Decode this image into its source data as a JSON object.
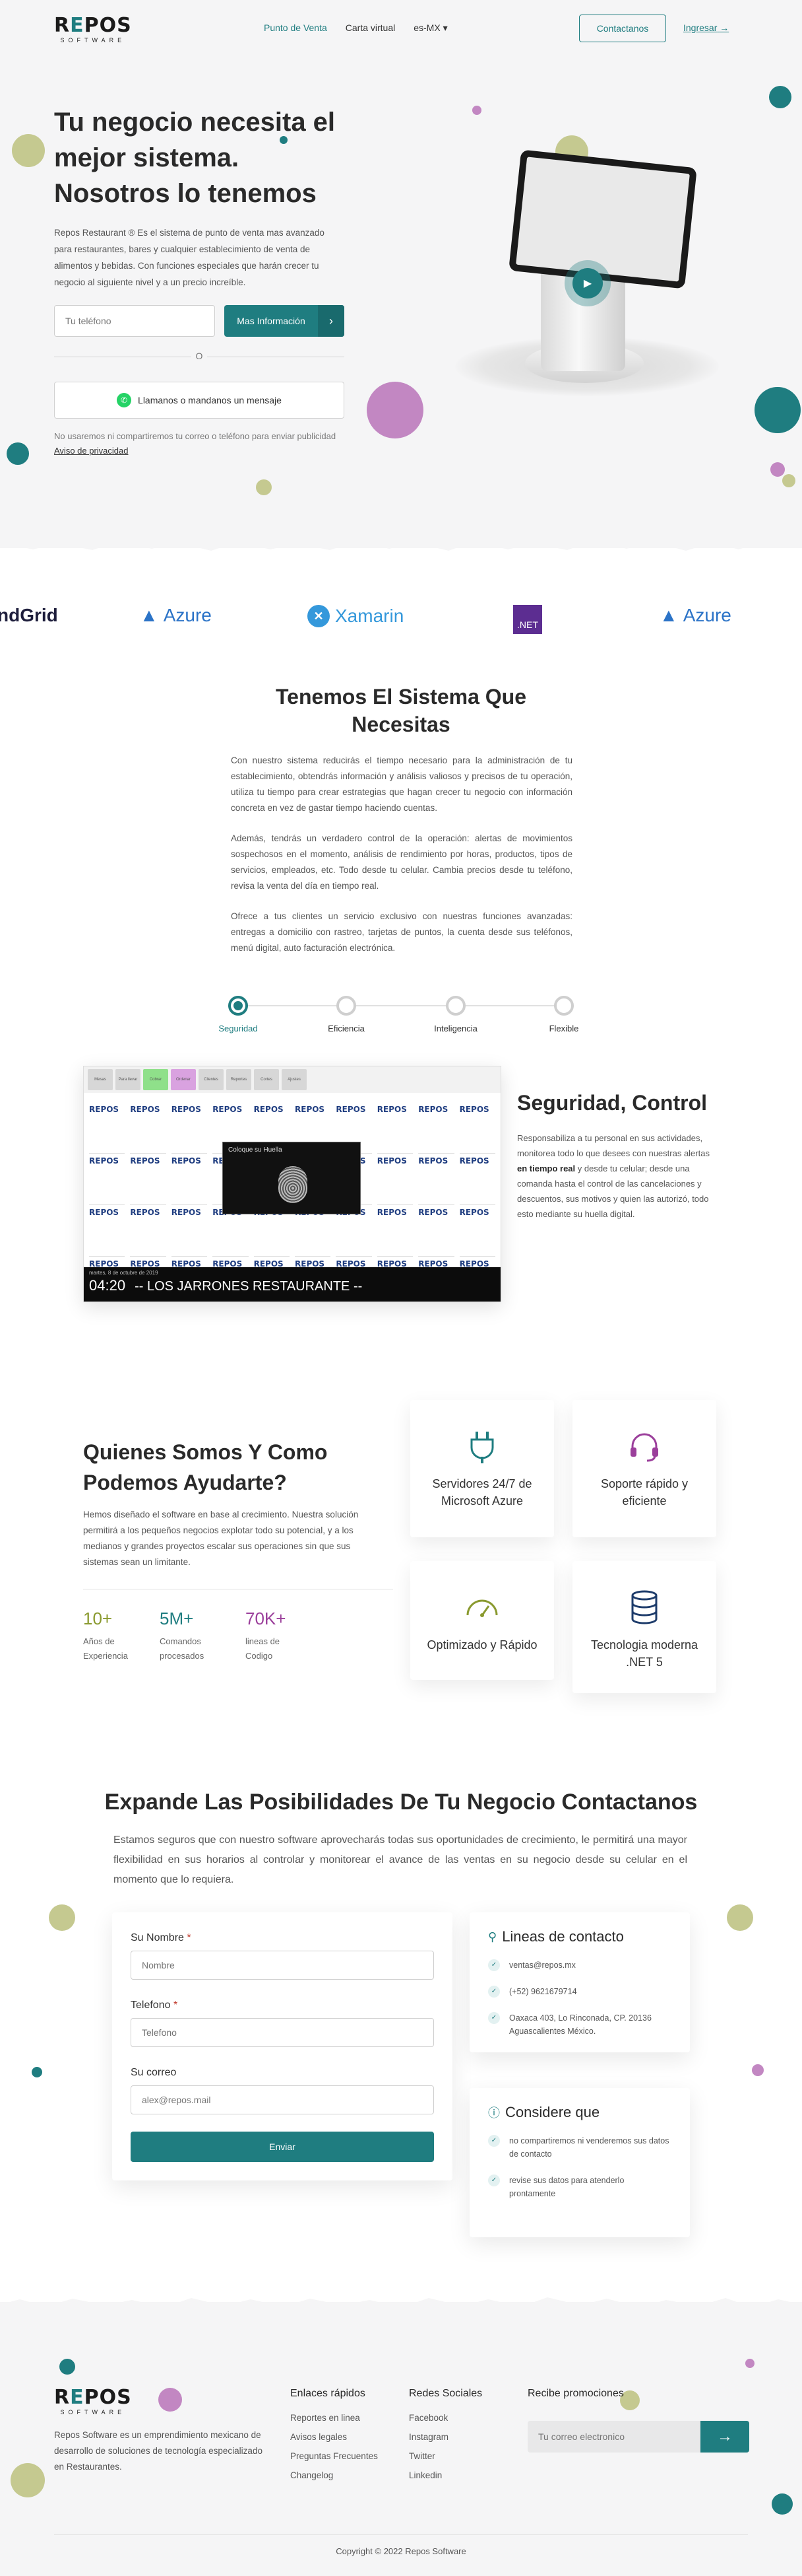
{
  "header": {
    "logo": {
      "word_a": "R",
      "word_e": "E",
      "word_b": "POS",
      "sub": "SOFTWARE"
    },
    "nav": [
      "Punto de Venta",
      "Carta virtual",
      "es-MX"
    ],
    "contact_button": "Contactanos",
    "login_link": "Ingresar"
  },
  "hero": {
    "title_line1": "Tu negocio necesita el",
    "title_line2": "mejor sistema.",
    "title_bold": "Nosotros lo tenemos",
    "description": "Repos Restaurant ® Es el sistema de punto de venta mas avanzado para restaurantes, bares y cualquier establecimiento de venta de alimentos y bebidas. Con funciones especiales que harán crecer tu negocio al siguiente nivel y a un precio increíble.",
    "phone_placeholder": "Tu teléfono",
    "info_button": "Mas Información",
    "or": "O",
    "whatsapp_button": "Llamanos o mandanos un mensaje",
    "privacy_text": "No usaremos ni compartiremos tu correo o teléfono para enviar publicidad",
    "privacy_link": "Aviso de privacidad"
  },
  "tech_strip": [
    {
      "name": "ndGrid",
      "mark": ""
    },
    {
      "name": "Azure",
      "mark": "▲"
    },
    {
      "name": "Xamarin",
      "mark": "✕"
    },
    {
      "name": ".NET",
      "mark": ""
    },
    {
      "name": "Azure",
      "mark": "▲"
    }
  ],
  "sistema": {
    "title_plain": "Tenemos ",
    "title_bold": "El Sistema Que Necesitas",
    "p1": "Con nuestro sistema reducirás el tiempo necesario para la administración de tu establecimiento, obtendrás información y análisis valiosos y precisos de tu operación, utiliza tu tiempo para crear estrategias que hagan crecer tu negocio con información concreta en vez de gastar tiempo haciendo cuentas.",
    "p2_a": "Además, tendrás un verdadero control de la operación: alertas de movimientos sospechosos en el momento, análisis de rendimiento por horas, productos, tipos de servicios, empleados, etc. Todo desde tu celular. Cambia precios desde tu teléfono, revisa la venta del día en tiempo real.",
    "p3": "Ofrece a tus clientes un servicio exclusivo con nuestras funciones avanzadas: entregas a domicilio con rastreo, tarjetas de puntos, la cuenta desde sus teléfonos, menú digital, auto facturación electrónica.",
    "steps": [
      "Seguridad",
      "Eficiencia",
      "Inteligencia",
      "Flexible"
    ]
  },
  "screenshot": {
    "toolbar": [
      "Mesas",
      "Para llevar",
      "Cobrar",
      "Ordenar",
      "Clientes",
      "Reportes",
      "Cortes",
      "Ajustes"
    ],
    "tiles_logo": "REPOS",
    "modal_title": "Coloque su Huella",
    "date": "martes, 8 de octubre de 2019",
    "time": "04:20",
    "restaurant": "-- LOS JARRONES RESTAURANTE --"
  },
  "control": {
    "title_plain": "Seguridad, ",
    "title_bold": "Control",
    "desc_a": "Responsabiliza a tu personal en sus actividades, monitorea todo lo que desees con nuestras alertas ",
    "desc_bold": "en tiempo real",
    "desc_b": " y desde tu celular; desde una comanda hasta el control de las cancelaciones y descuentos, sus motivos y quien las autorizó, todo esto mediante su huella digital."
  },
  "quienes": {
    "title_plain": "Quienes Somos Y ",
    "title_bold": "Como Podemos Ayudarte?",
    "description": "Hemos diseñado el software en base al crecimiento. Nuestra solución permitirá a los pequeños negocios explotar todo su potencial, y a los medianos y grandes proyectos escalar sus operaciones sin que sus sistemas sean un limitante.",
    "stats": [
      {
        "value": "10+",
        "label_1": "Años de",
        "label_2": "Experiencia"
      },
      {
        "value": "5M+",
        "label_1": "Comandos",
        "label_2": "procesados"
      },
      {
        "value": "70K+",
        "label_1": "lineas de",
        "label_2": "Codigo"
      }
    ],
    "cards": [
      "Servidores 24/7 de Microsoft Azure",
      "Soporte rápido y eficiente",
      "Optimizado y Rápido",
      "Tecnologia moderna .NET 5"
    ]
  },
  "expande": {
    "title_plain": "Expande Las Posibilidades De Tu Negocio ",
    "title_bold": "Contactanos",
    "description": "Estamos seguros que con nuestro software aprovecharás todas sus oportunidades de crecimiento, le permitirá una mayor flexibilidad en sus horarios al controlar y monitorear el avance de las ventas en su negocio desde su celular en el momento que lo requiera."
  },
  "form": {
    "name_label": "Su Nombre",
    "name_placeholder": "Nombre",
    "phone_label": "Telefono",
    "phone_placeholder": "Telefono",
    "email_label": "Su correo",
    "email_placeholder": "alex@repos.mail",
    "required_mark": "*",
    "submit": "Enviar"
  },
  "contact_lines": {
    "title": "Lineas de contacto",
    "items": [
      "ventas@repos.mx",
      "(+52) 9621679714",
      "Oaxaca 403, Lo Rinconada, CP. 20136 Aguascalientes México."
    ]
  },
  "considere": {
    "title": "Considere que",
    "items": [
      "no compartiremos ni venderemos sus datos de contacto",
      "revise sus datos para atenderlo prontamente"
    ]
  },
  "footer": {
    "about": "Repos Software es un emprendimiento mexicano de desarrollo de soluciones de tecnología especializado en Restaurantes.",
    "quick_title": "Enlaces rápidos",
    "quick_links": [
      "Reportes en linea",
      "Avisos legales",
      "Preguntas Frecuentes",
      "Changelog"
    ],
    "social_title": "Redes Sociales",
    "social_links": [
      "Facebook",
      "Instagram",
      "Twitter",
      "Linkedin"
    ],
    "promo_title": "Recibe promociones",
    "promo_placeholder": "Tu correo electronico",
    "copyright": "Copyright © 2022 Repos Software"
  },
  "colors": {
    "accent": "#1f7d80",
    "olive": "#c5c990",
    "purple": "#c287c2",
    "hero_bg": "#f5f5f6"
  },
  "icons": {
    "arrow_right": "→",
    "chevron_down": "▾",
    "check": "✓",
    "play": "▶",
    "location_pin": "⚲",
    "info": "ⓘ"
  }
}
